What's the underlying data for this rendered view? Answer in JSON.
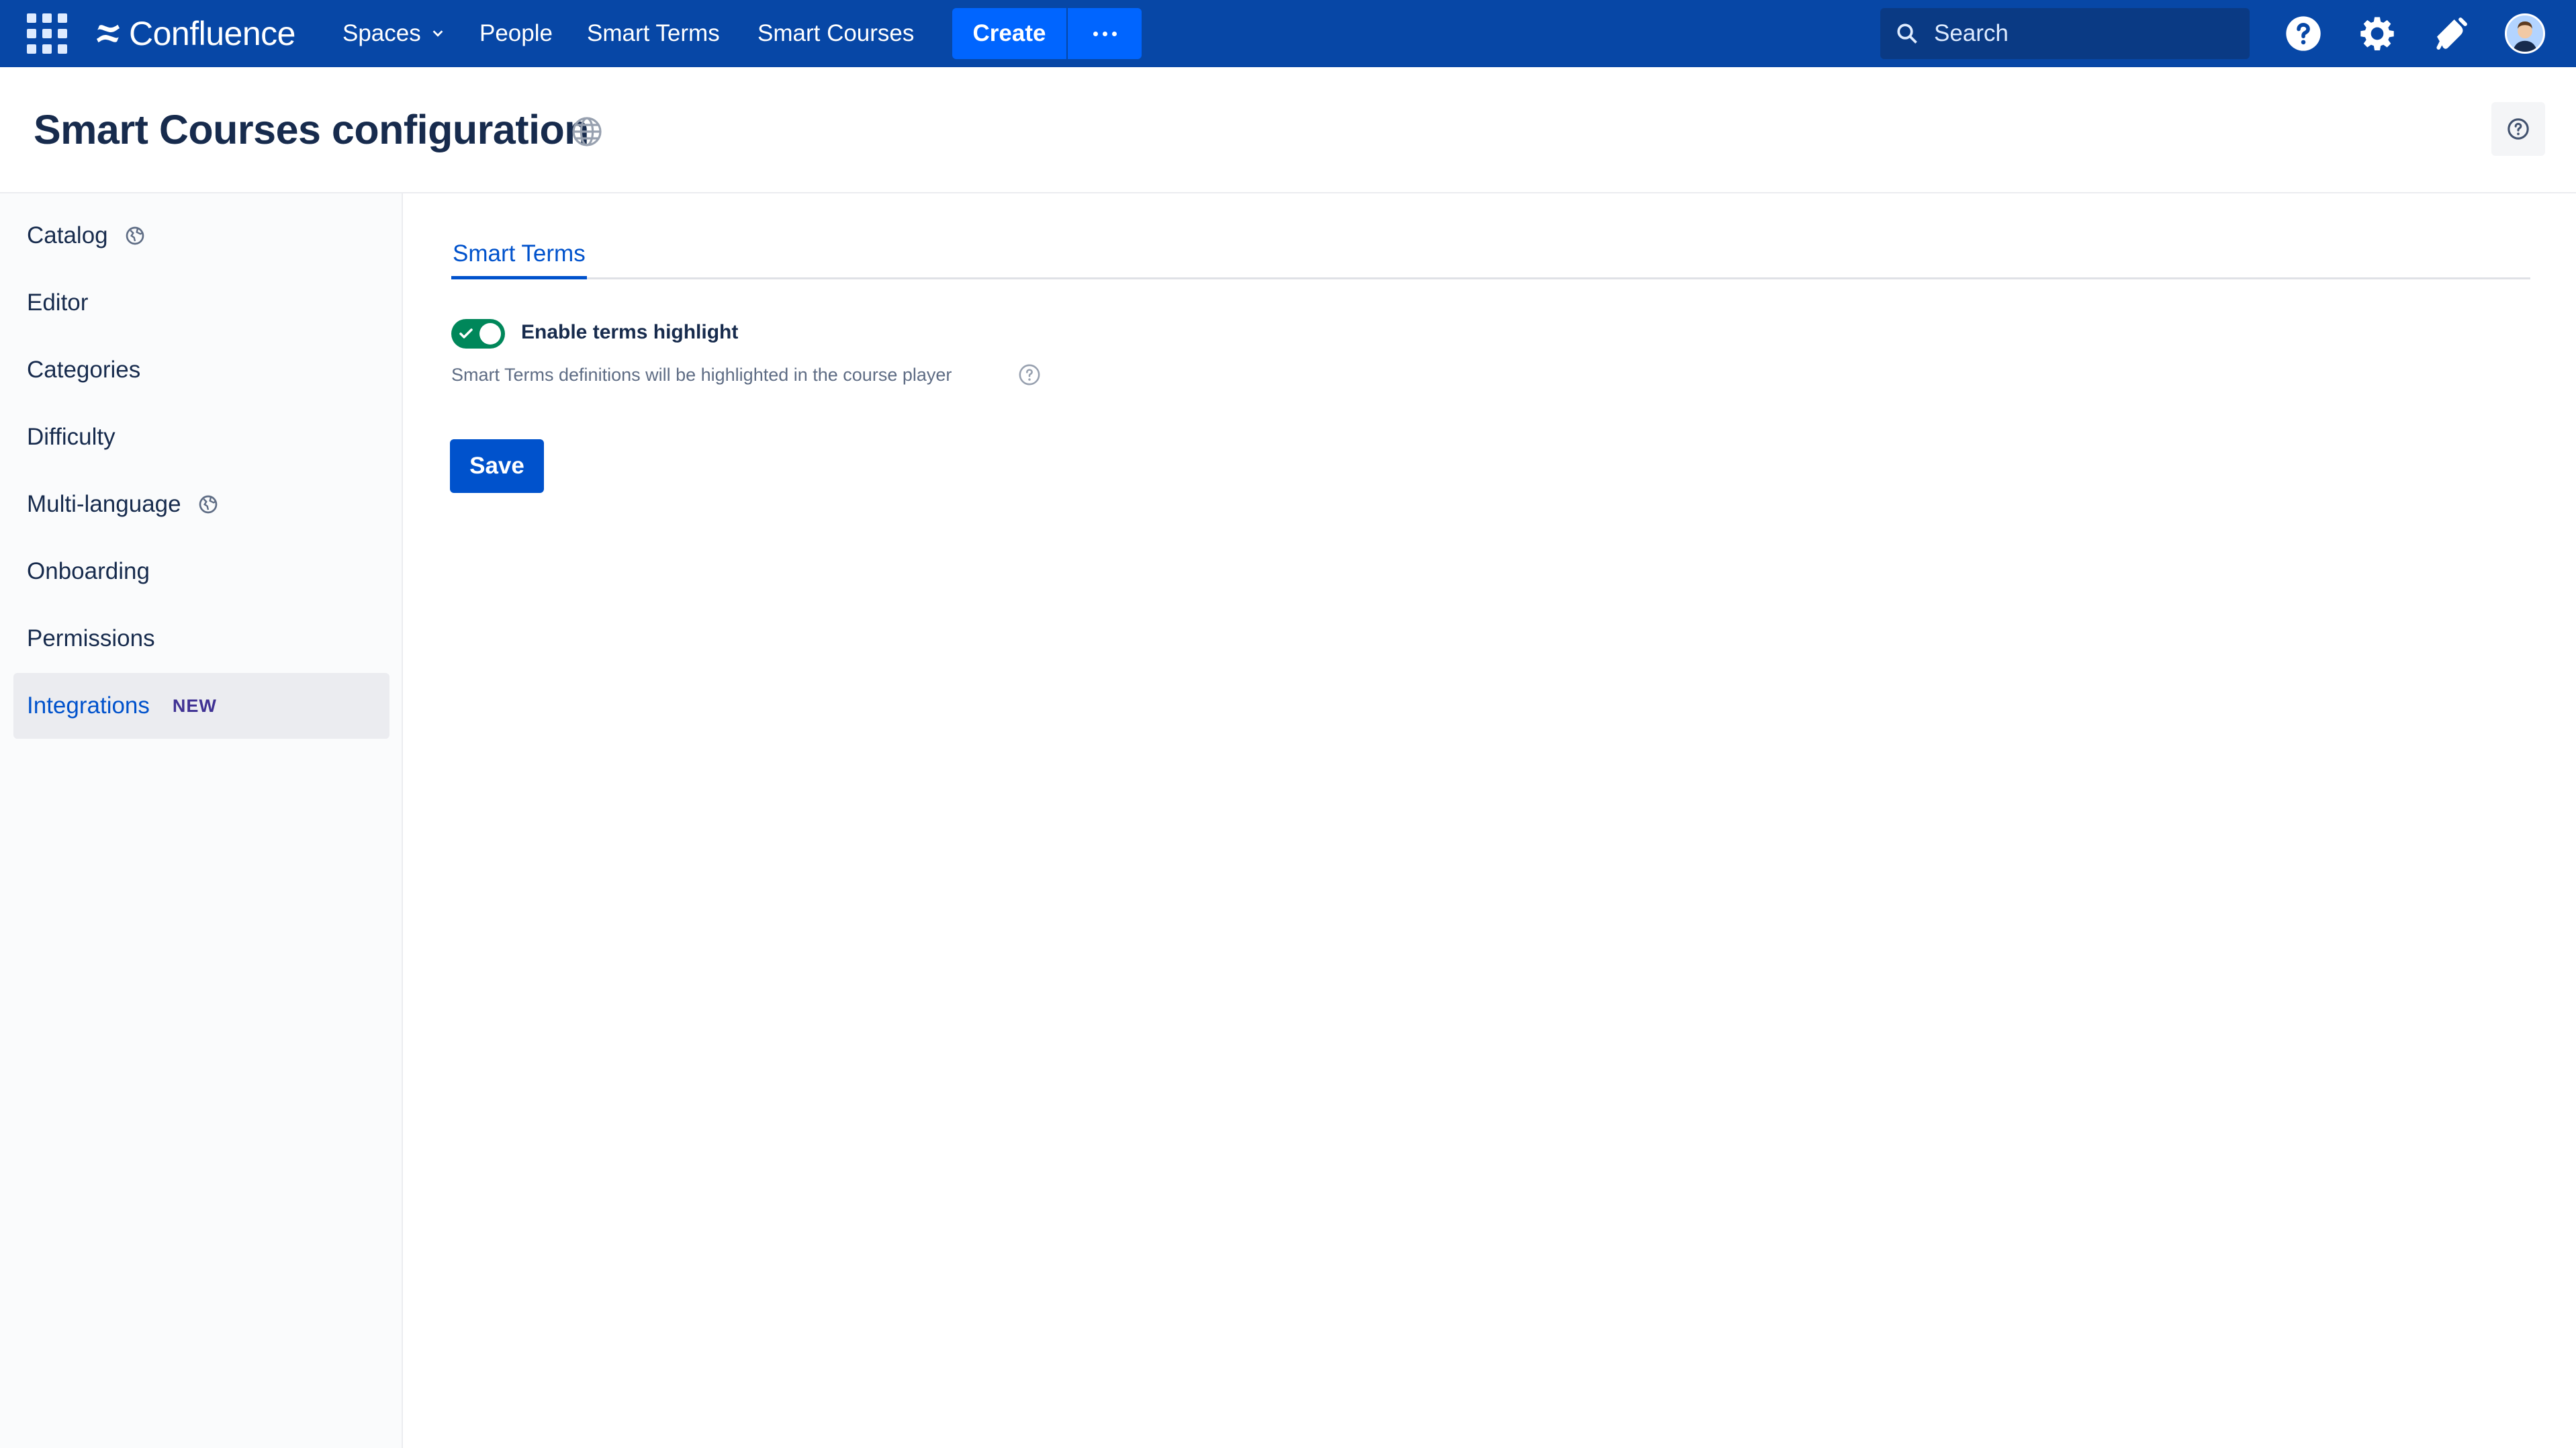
{
  "topnav": {
    "logo_text": "Confluence",
    "items": [
      "Spaces",
      "People",
      "Smart Terms",
      "Smart Courses"
    ],
    "create_label": "Create",
    "search_placeholder": "Search",
    "accent": "#0747a6",
    "button_color": "#0065ff"
  },
  "header": {
    "title": "Smart Courses configuration"
  },
  "sidebar": {
    "items": [
      {
        "label": "Catalog",
        "icon": "globe-icon"
      },
      {
        "label": "Editor"
      },
      {
        "label": "Categories"
      },
      {
        "label": "Difficulty"
      },
      {
        "label": "Multi-language",
        "icon": "globe-icon"
      },
      {
        "label": "Onboarding"
      },
      {
        "label": "Permissions"
      },
      {
        "label": "Integrations",
        "badge": "NEW",
        "active": true
      }
    ]
  },
  "main": {
    "tabs": [
      "Smart Terms"
    ],
    "toggle": {
      "label": "Enable terms highlight",
      "on": true
    },
    "helper_text": "Smart Terms definitions will be highlighted in the course player",
    "save_label": "Save"
  }
}
